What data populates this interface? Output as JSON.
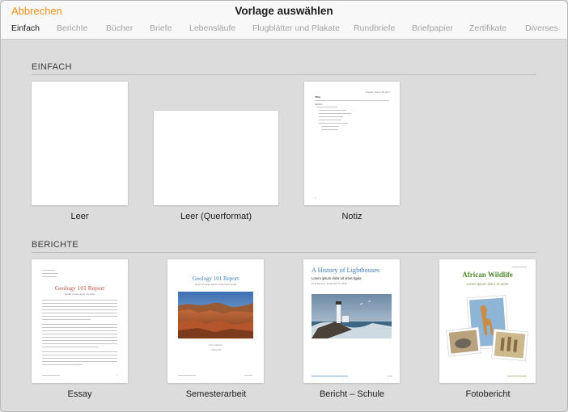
{
  "header": {
    "cancel_label": "Abbrechen",
    "title": "Vorlage auswählen",
    "tabs": [
      {
        "label": "Einfach",
        "active": true
      },
      {
        "label": "Berichte"
      },
      {
        "label": "Bücher"
      },
      {
        "label": "Briefe"
      },
      {
        "label": "Lebensläufe"
      },
      {
        "label": "Flugblätter und Plakate"
      },
      {
        "label": "Rundbriefe"
      },
      {
        "label": "Briefpapier"
      },
      {
        "label": "Zertifikate"
      },
      {
        "label": "Diverses"
      }
    ]
  },
  "sections": {
    "basic": {
      "title": "EINFACH",
      "templates": [
        {
          "label": "Leer"
        },
        {
          "label": "Leer (Querformat)"
        },
        {
          "label": "Notiz"
        }
      ]
    },
    "reports": {
      "title": "BERICHTE",
      "templates": [
        {
          "label": "Essay"
        },
        {
          "label": "Semesterarbeit"
        },
        {
          "label": "Bericht – Schule"
        },
        {
          "label": "Fotobericht"
        }
      ]
    }
  },
  "previews": {
    "note": {
      "date": "Tuesday, March 28, 2017",
      "title": "Title",
      "subtitle": "Subtitle",
      "page": "1"
    },
    "essay": {
      "title": "Geology 101 Report",
      "subtitle": "Ipsum lorem dolor sit amet",
      "page": "1"
    },
    "term_paper": {
      "title": "Geology 101 Report",
      "subtitle": "Dolor sit amet, ipsum consectetur lorem",
      "author": "Urna Semper",
      "date": "1.08.2018"
    },
    "school_report": {
      "title": "A History of Lighthouses",
      "subtitle": "Lorem ipsum dolor sit amet ligula",
      "meta": "Urna Semper · December 11, 2018"
    },
    "photo_report": {
      "title": "African Wildlife",
      "subtitle": "Lorem ipsum dolor sit amet"
    }
  },
  "colors": {
    "accent": "#f0901e",
    "tab_inactive": "#a4a4a4",
    "background": "#dcdcdc",
    "essay_title": "#c0503e",
    "wildlife_title": "#4e8a2c",
    "lighthouse_title": "#3a7ab8"
  }
}
